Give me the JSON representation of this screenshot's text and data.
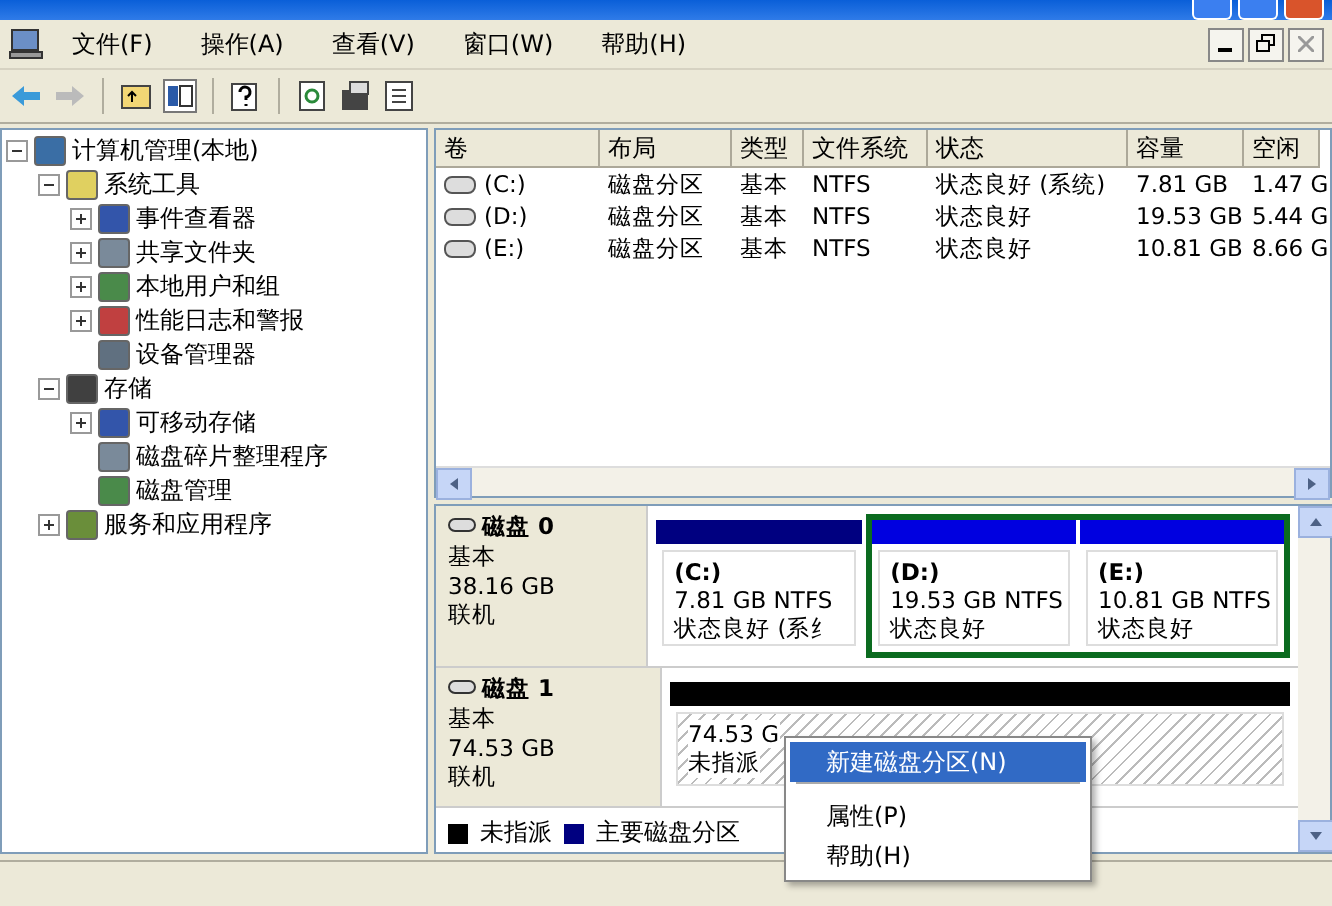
{
  "menu_bar": [
    "文件(F)",
    "操作(A)",
    "查看(V)",
    "窗口(W)",
    "帮助(H)"
  ],
  "tree": [
    {
      "label": "计算机管理(本地)",
      "expanded": true,
      "children": [
        {
          "label": "系统工具",
          "expanded": true,
          "children": [
            {
              "label": "事件查看器",
              "expanded": false
            },
            {
              "label": "共享文件夹",
              "expanded": false
            },
            {
              "label": "本地用户和组",
              "expanded": false
            },
            {
              "label": "性能日志和警报",
              "expanded": false
            },
            {
              "label": "设备管理器"
            }
          ]
        },
        {
          "label": "存储",
          "expanded": true,
          "children": [
            {
              "label": "可移动存储",
              "expanded": false
            },
            {
              "label": "磁盘碎片整理程序"
            },
            {
              "label": "磁盘管理"
            }
          ]
        },
        {
          "label": "服务和应用程序",
          "expanded": false
        }
      ]
    }
  ],
  "volume_table": {
    "columns": [
      "卷",
      "布局",
      "类型",
      "文件系统",
      "状态",
      "容量",
      "空闲"
    ],
    "rows": [
      [
        "(C:)",
        "磁盘分区",
        "基本",
        "NTFS",
        "状态良好 (系统)",
        "7.81 GB",
        "1.47 G"
      ],
      [
        "(D:)",
        "磁盘分区",
        "基本",
        "NTFS",
        "状态良好",
        "19.53 GB",
        "5.44 G"
      ],
      [
        "(E:)",
        "磁盘分区",
        "基本",
        "NTFS",
        "状态良好",
        "10.81 GB",
        "8.66 G"
      ]
    ]
  },
  "disks": [
    {
      "name": "磁盘 0",
      "type": "基本",
      "size": "38.16 GB",
      "status": "联机",
      "partitions": [
        {
          "kind": "primary",
          "label": "(C:)",
          "size": "7.81 GB NTFS",
          "status": "状态良好 (系纟"
        },
        {
          "kind": "logical",
          "label": "(D:)",
          "size": "19.53 GB NTFS",
          "status": "状态良好"
        },
        {
          "kind": "logical",
          "label": "(E:)",
          "size": "10.81 GB NTFS",
          "status": "状态良好"
        }
      ]
    },
    {
      "name": "磁盘 1",
      "type": "基本",
      "size": "74.53 GB",
      "status": "联机",
      "partitions": [
        {
          "kind": "unallocated",
          "size": "74.53 G",
          "status": "未指派"
        }
      ]
    }
  ],
  "legend": [
    {
      "label": "未指派",
      "color": "#000000"
    },
    {
      "label": "主要磁盘分区",
      "color": "#000080"
    }
  ],
  "context_menu": [
    {
      "label": "新建磁盘分区(N)",
      "selected": true,
      "separator_after": true
    },
    {
      "label": "属性(P)",
      "selected": false,
      "separator_after": false
    },
    {
      "label": "帮助(H)",
      "selected": false,
      "separator_after": false
    }
  ]
}
